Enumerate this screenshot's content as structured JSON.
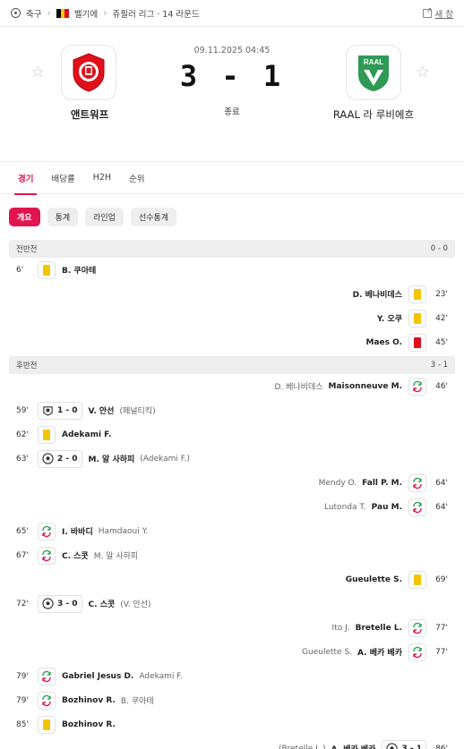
{
  "breadcrumb": {
    "sport": "축구",
    "country": "벨기에",
    "league": "쥬필러 리그 · 14 라운드",
    "new_window": "새 창"
  },
  "match": {
    "home_name": "앤트워프",
    "away_name": "RAAL 라 루비에흐",
    "datetime": "09.11.2025 04:45",
    "score": "3 - 1",
    "status": "종료",
    "away_logo_text": "RAAL",
    "home_logo_text": "1"
  },
  "tabs": [
    "경기",
    "배당률",
    "H2H",
    "순위"
  ],
  "pills": [
    "개요",
    "통계",
    "라인업",
    "선수통계"
  ],
  "colors": {
    "accent": "#e0154f",
    "yellow_card": "#f5c400",
    "red_card": "#e0101a",
    "sub_green": "#2ea44f",
    "sub_red": "#e0154f"
  },
  "first_half": {
    "label": "전반전",
    "score": "0 - 0",
    "events": [
      {
        "side": "home",
        "minute": "6'",
        "type": "yellow",
        "player": "B. 쿠아테"
      },
      {
        "side": "away",
        "minute": "23'",
        "type": "yellow",
        "player": "D. 베나비데스"
      },
      {
        "side": "away",
        "minute": "42'",
        "type": "yellow",
        "player": "Y. 오쿠"
      },
      {
        "side": "away",
        "minute": "45'",
        "type": "red",
        "player": "Maes O."
      }
    ]
  },
  "second_half": {
    "label": "후반전",
    "score": "3 - 1",
    "events": [
      {
        "side": "away",
        "minute": "46'",
        "type": "sub",
        "player": "Maisonneuve M.",
        "other": "D. 베나비데스"
      },
      {
        "side": "home",
        "minute": "59'",
        "type": "penalty",
        "score": "1 - 0",
        "player": "V. 안선",
        "other": "(페널티킥)"
      },
      {
        "side": "home",
        "minute": "62'",
        "type": "yellow",
        "player": "Adekami F."
      },
      {
        "side": "home",
        "minute": "63'",
        "type": "goal",
        "score": "2 - 0",
        "player": "M. 알 사하피",
        "other": "(Adekami F.)"
      },
      {
        "side": "away",
        "minute": "64'",
        "type": "sub",
        "player": "Fall P. M.",
        "other": "Mendy O."
      },
      {
        "side": "away",
        "minute": "64'",
        "type": "sub",
        "player": "Pau M.",
        "other": "Lutonda T."
      },
      {
        "side": "home",
        "minute": "65'",
        "type": "sub",
        "player": "I. 바바디",
        "other": "Hamdaoui Y."
      },
      {
        "side": "home",
        "minute": "67'",
        "type": "sub",
        "player": "C. 스콧",
        "other": "M. 알 사하피"
      },
      {
        "side": "away",
        "minute": "69'",
        "type": "yellow",
        "player": "Gueulette S."
      },
      {
        "side": "home",
        "minute": "72'",
        "type": "goal",
        "score": "3 - 0",
        "player": "C. 스콧",
        "other": "(V. 안선)"
      },
      {
        "side": "away",
        "minute": "77'",
        "type": "sub",
        "player": "Bretelle L.",
        "other": "Ito J."
      },
      {
        "side": "away",
        "minute": "77'",
        "type": "sub",
        "player": "A. 베카 베카",
        "other": "Gueulette S."
      },
      {
        "side": "home",
        "minute": "79'",
        "type": "sub",
        "player": "Gabriel Jesus D.",
        "other": "Adekami F."
      },
      {
        "side": "home",
        "minute": "79'",
        "type": "sub",
        "player": "Bozhinov R.",
        "other": "B. 쿠아테"
      },
      {
        "side": "home",
        "minute": "85'",
        "type": "yellow",
        "player": "Bozhinov R."
      },
      {
        "side": "away",
        "minute": "86'",
        "type": "goal",
        "score": "3 - 1",
        "player": "A. 베카 베카",
        "other": "(Bretelle L.)"
      }
    ]
  }
}
